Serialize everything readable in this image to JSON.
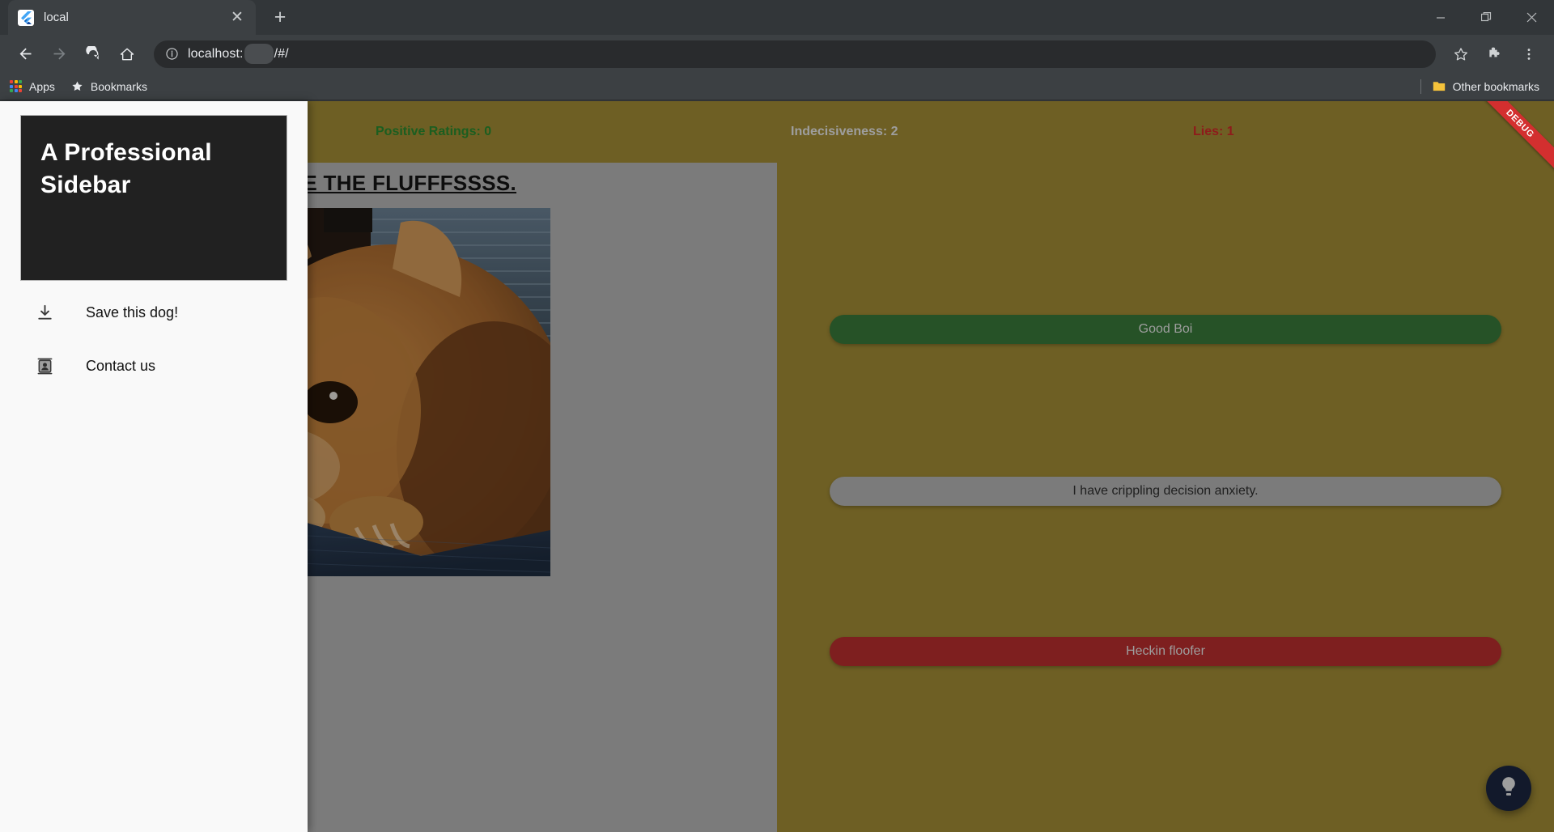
{
  "browser": {
    "tab": {
      "title": "local",
      "favicon_icon": "flutter-logo-icon",
      "close_icon": "close-icon"
    },
    "newtab_icon": "plus-icon",
    "window": {
      "minimize_icon": "minimize-icon",
      "restore_icon": "restore-icon",
      "close_icon": "close-icon"
    },
    "nav": {
      "back_icon": "back-arrow-icon",
      "forward_icon": "forward-arrow-icon",
      "reload_icon": "reload-icon",
      "home_icon": "home-icon",
      "bookmark_star_icon": "star-icon",
      "extensions_icon": "puzzle-piece-icon",
      "menu_icon": "three-dot-menu-icon"
    },
    "omnibox": {
      "site_info_icon": "info-circle-icon",
      "url_prefix": "localhost:",
      "url_suffix": "/#/"
    },
    "bookmarks": {
      "apps_label": "Apps",
      "apps_icon": "apps-grid-icon",
      "bookmarks_label": "Bookmarks",
      "bookmarks_icon": "star-icon",
      "other_label": "Other bookmarks",
      "other_icon": "folder-icon"
    }
  },
  "app": {
    "debug_banner": "DEBUG",
    "stats": [
      {
        "label": "Positive Ratings: 0",
        "color": "#1b5e20"
      },
      {
        "label": "Indecisiveness: 2",
        "color": "#9e9e9e"
      },
      {
        "label": "Lies: 1",
        "color": "#8e1b1b"
      }
    ],
    "heading": "RATE THE FLUFFFSSSS.",
    "dog_image_alt": "pomeranian-dog-photo",
    "rating_buttons": [
      {
        "label": "Good Boi",
        "bg": "#265227",
        "fg": "#9e9e9e"
      },
      {
        "label": "I have crippling decision anxiety.",
        "bg": "#7b7b7b",
        "fg": "#1f1f1f"
      },
      {
        "label": "Heckin floofer",
        "bg": "#7e1f1f",
        "fg": "#9e9e9e"
      }
    ],
    "fab": {
      "icon": "lightbulb-icon",
      "bg": "#12192b",
      "fg": "#9e9e9e"
    },
    "sidebar": {
      "header_title": "A Professional Sidebar",
      "items": [
        {
          "label": "Save this dog!",
          "icon": "download-icon"
        },
        {
          "label": "Contact us",
          "icon": "contact-card-icon"
        }
      ]
    }
  },
  "theme": {
    "olive": "#6e5f24",
    "gray_pane": "#7b7b7b",
    "sidebar_bg": "#f9f9f9",
    "sidebar_header_bg": "#212121"
  }
}
